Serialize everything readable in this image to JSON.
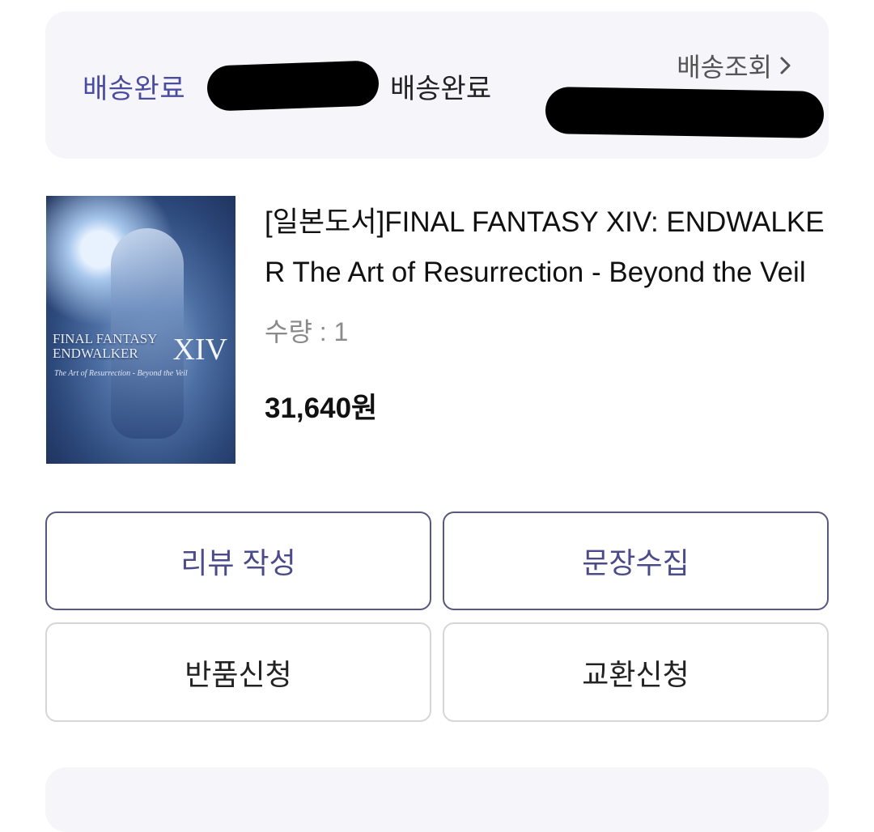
{
  "order_status": {
    "label": "배송완료",
    "status_text": "배송완료",
    "track_link": "배송조회"
  },
  "product": {
    "title": "[일본도서]FINAL FANTASY XIV: ENDWALKER The Art of Resurrection - Beyond the Veil",
    "quantity_label": "수량 : 1",
    "price": "31,640원",
    "cover": {
      "title_line1": "FINAL FANTASY",
      "title_line2": "ENDWALKER",
      "numeral": "XIV",
      "subtitle": "The Art of Resurrection - Beyond the Veil"
    }
  },
  "actions": {
    "write_review": "리뷰 작성",
    "collect_quote": "문장수집",
    "request_return": "반품신청",
    "request_exchange": "교환신청"
  },
  "colors": {
    "accent": "#4b4b8c",
    "card_bg": "#f5f5fa"
  }
}
